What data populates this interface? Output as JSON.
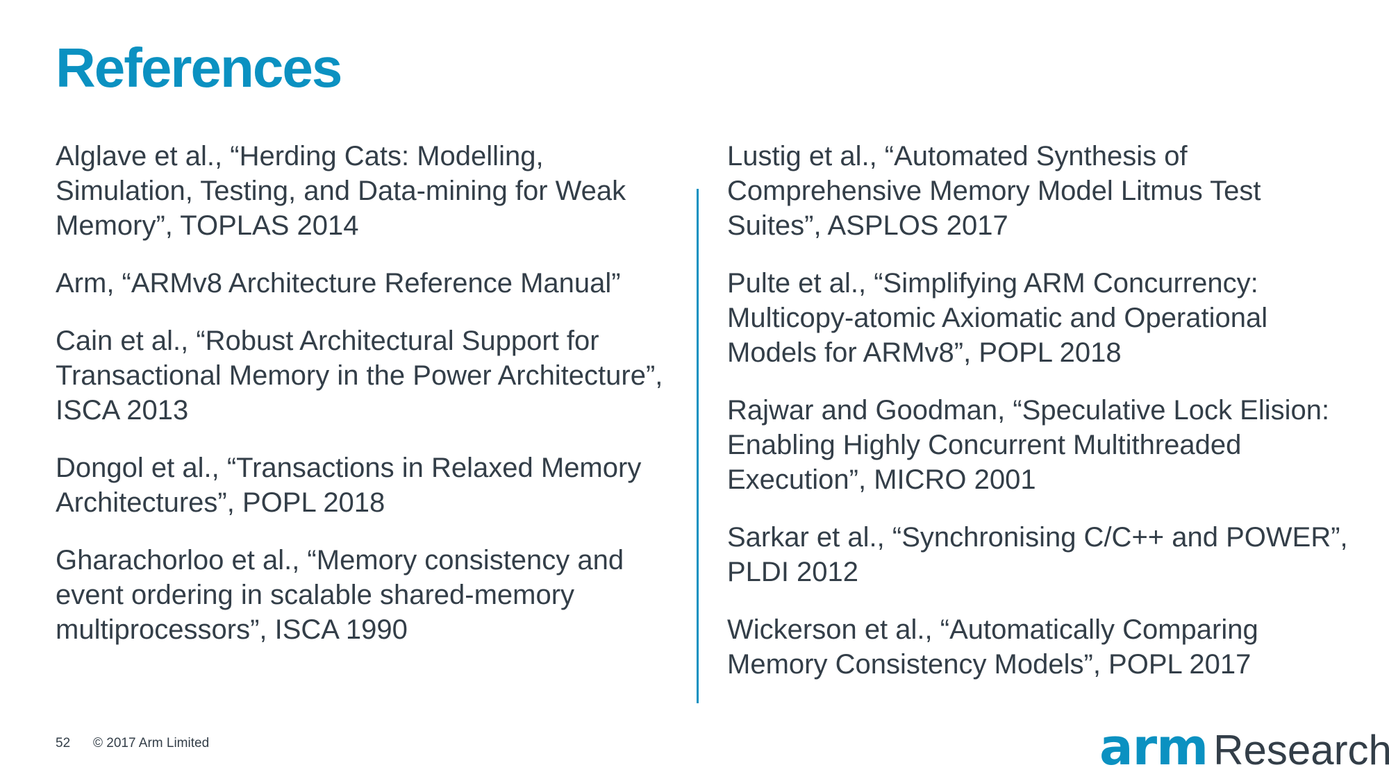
{
  "title": "References",
  "left_references": [
    "Alglave et al., “Herding Cats: Modelling, Simulation, Testing, and Data-mining for Weak Memory”, TOPLAS 2014",
    "Arm, “ARMv8 Architecture Reference Manual”",
    "Cain et al., “Robust Architectural Support for Transactional Memory in the Power Architecture”, ISCA 2013",
    "Dongol et al., “Transactions in Relaxed Memory Architectures”, POPL 2018",
    "Gharachorloo et al., “Memory consistency and event ordering in scalable shared-memory multiprocessors”, ISCA 1990"
  ],
  "right_references": [
    "Lustig et al., “Automated Synthesis of Comprehensive Memory Model Litmus Test Suites”, ASPLOS 2017",
    "Pulte et al., “Simplifying ARM Concurrency: Multicopy-atomic Axiomatic and Operational Models for ARMv8”, POPL 2018",
    "Rajwar and Goodman, “Speculative Lock Elision: Enabling Highly Concurrent Multithreaded Execution”, MICRO 2001",
    "Sarkar et al., “Synchronising C/C++ and POWER”, PLDI 2012",
    "Wickerson et al., “Automatically Comparing Memory Consistency Models”, POPL 2017"
  ],
  "footer": {
    "page_number": "52",
    "copyright": "© 2017 Arm Limited"
  },
  "logo": {
    "brand": "arm",
    "suffix": "Research"
  },
  "colors": {
    "accent": "#0b91c1",
    "text": "#333e48",
    "background": "#ffffff"
  }
}
